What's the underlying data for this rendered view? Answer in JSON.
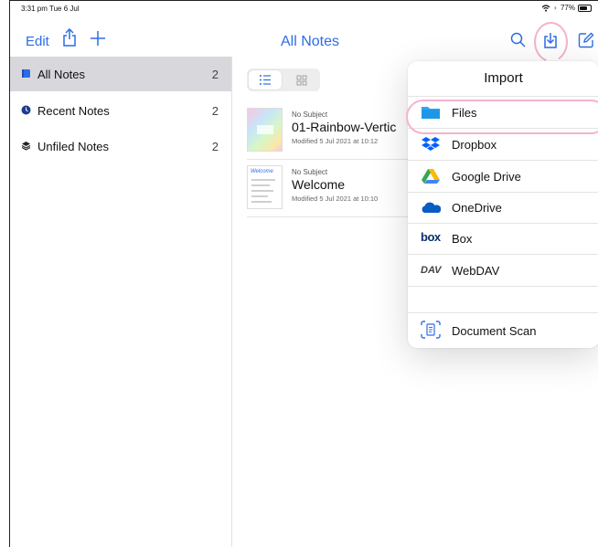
{
  "status_bar": {
    "time": "3:31 pm  Tue 6 Jul",
    "battery": "77%"
  },
  "nav": {
    "edit": "Edit",
    "title": "All Notes"
  },
  "sidebar": {
    "items": [
      {
        "label": "All Notes",
        "count": "2"
      },
      {
        "label": "Recent Notes",
        "count": "2"
      },
      {
        "label": "Unfiled Notes",
        "count": "2"
      }
    ]
  },
  "notes": [
    {
      "subject": "No Subject",
      "title": "01-Rainbow-Vertic",
      "modified": "Modified 5 Jul 2021 at 10:12"
    },
    {
      "subject": "No Subject",
      "title": "Welcome",
      "modified": "Modified 5 Jul 2021 at 10:10",
      "thumb_text": "Welcome"
    }
  ],
  "import_menu": {
    "title": "Import",
    "items": [
      {
        "label": "Files"
      },
      {
        "label": "Dropbox"
      },
      {
        "label": "Google Drive"
      },
      {
        "label": "OneDrive"
      },
      {
        "label": "Box",
        "icon_text": "box"
      },
      {
        "label": "WebDAV",
        "icon_text": "DAV"
      },
      {
        "label": "Document Scan"
      }
    ]
  },
  "colors": {
    "accent": "#2e6ce6",
    "highlight": "#f3b2cf",
    "files_blue": "#2aa8f5"
  }
}
